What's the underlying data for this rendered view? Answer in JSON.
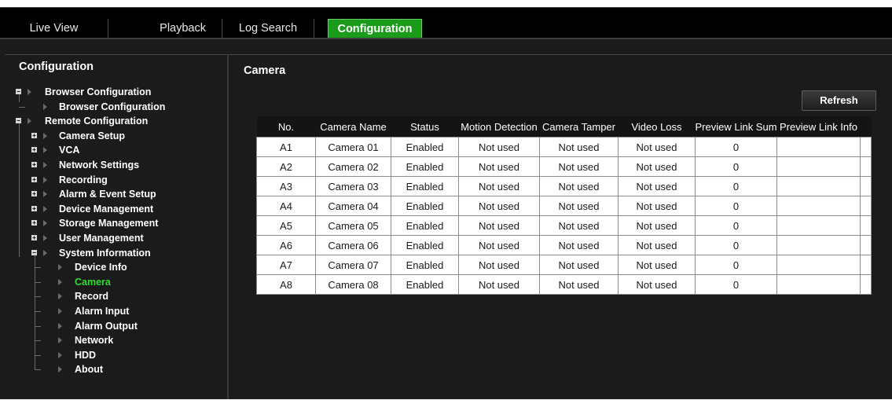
{
  "topnav": {
    "tabs": [
      {
        "label": "Live View",
        "active": false
      },
      {
        "label": "Playback",
        "active": false
      },
      {
        "label": "Log Search",
        "active": false
      },
      {
        "label": "Configuration",
        "active": true
      }
    ]
  },
  "sidebar": {
    "title": "Configuration",
    "tree": [
      {
        "label": "Browser Configuration",
        "toggle": "collapse",
        "selected": false
      },
      {
        "label": "Browser Configuration",
        "toggle": null,
        "selected": false
      },
      {
        "label": "Remote Configuration",
        "toggle": "collapse",
        "selected": false
      },
      {
        "label": "Camera Setup",
        "toggle": "expand",
        "selected": false
      },
      {
        "label": "VCA",
        "toggle": "expand",
        "selected": false
      },
      {
        "label": "Network Settings",
        "toggle": "expand",
        "selected": false
      },
      {
        "label": "Recording",
        "toggle": "expand",
        "selected": false
      },
      {
        "label": "Alarm & Event Setup",
        "toggle": "expand",
        "selected": false
      },
      {
        "label": "Device Management",
        "toggle": "expand",
        "selected": false
      },
      {
        "label": "Storage Management",
        "toggle": "expand",
        "selected": false
      },
      {
        "label": "User Management",
        "toggle": "expand",
        "selected": false
      },
      {
        "label": "System Information",
        "toggle": "collapse",
        "selected": false
      },
      {
        "label": "Device Info",
        "toggle": null,
        "selected": false
      },
      {
        "label": "Camera",
        "toggle": null,
        "selected": true
      },
      {
        "label": "Record",
        "toggle": null,
        "selected": false
      },
      {
        "label": "Alarm Input",
        "toggle": null,
        "selected": false
      },
      {
        "label": "Alarm Output",
        "toggle": null,
        "selected": false
      },
      {
        "label": "Network",
        "toggle": null,
        "selected": false
      },
      {
        "label": "HDD",
        "toggle": null,
        "selected": false
      },
      {
        "label": "About",
        "toggle": null,
        "selected": false
      }
    ]
  },
  "main": {
    "title": "Camera",
    "refresh_label": "Refresh",
    "table": {
      "columns": [
        "No.",
        "Camera Name",
        "Status",
        "Motion Detection",
        "Camera Tamper",
        "Video Loss",
        "Preview Link Sum",
        "Preview Link Info"
      ],
      "rows": [
        [
          "A1",
          "Camera 01",
          "Enabled",
          "Not used",
          "Not used",
          "Not used",
          "0",
          ""
        ],
        [
          "A2",
          "Camera 02",
          "Enabled",
          "Not used",
          "Not used",
          "Not used",
          "0",
          ""
        ],
        [
          "A3",
          "Camera 03",
          "Enabled",
          "Not used",
          "Not used",
          "Not used",
          "0",
          ""
        ],
        [
          "A4",
          "Camera 04",
          "Enabled",
          "Not used",
          "Not used",
          "Not used",
          "0",
          ""
        ],
        [
          "A5",
          "Camera 05",
          "Enabled",
          "Not used",
          "Not used",
          "Not used",
          "0",
          ""
        ],
        [
          "A6",
          "Camera 06",
          "Enabled",
          "Not used",
          "Not used",
          "Not used",
          "0",
          ""
        ],
        [
          "A7",
          "Camera 07",
          "Enabled",
          "Not used",
          "Not used",
          "Not used",
          "0",
          ""
        ],
        [
          "A8",
          "Camera 08",
          "Enabled",
          "Not used",
          "Not used",
          "Not used",
          "0",
          ""
        ]
      ]
    }
  },
  "colors": {
    "accent": "#1a9b1a",
    "selected_text": "#2fdc2f",
    "background": "#1b1b1b",
    "nav_background": "#000000"
  }
}
